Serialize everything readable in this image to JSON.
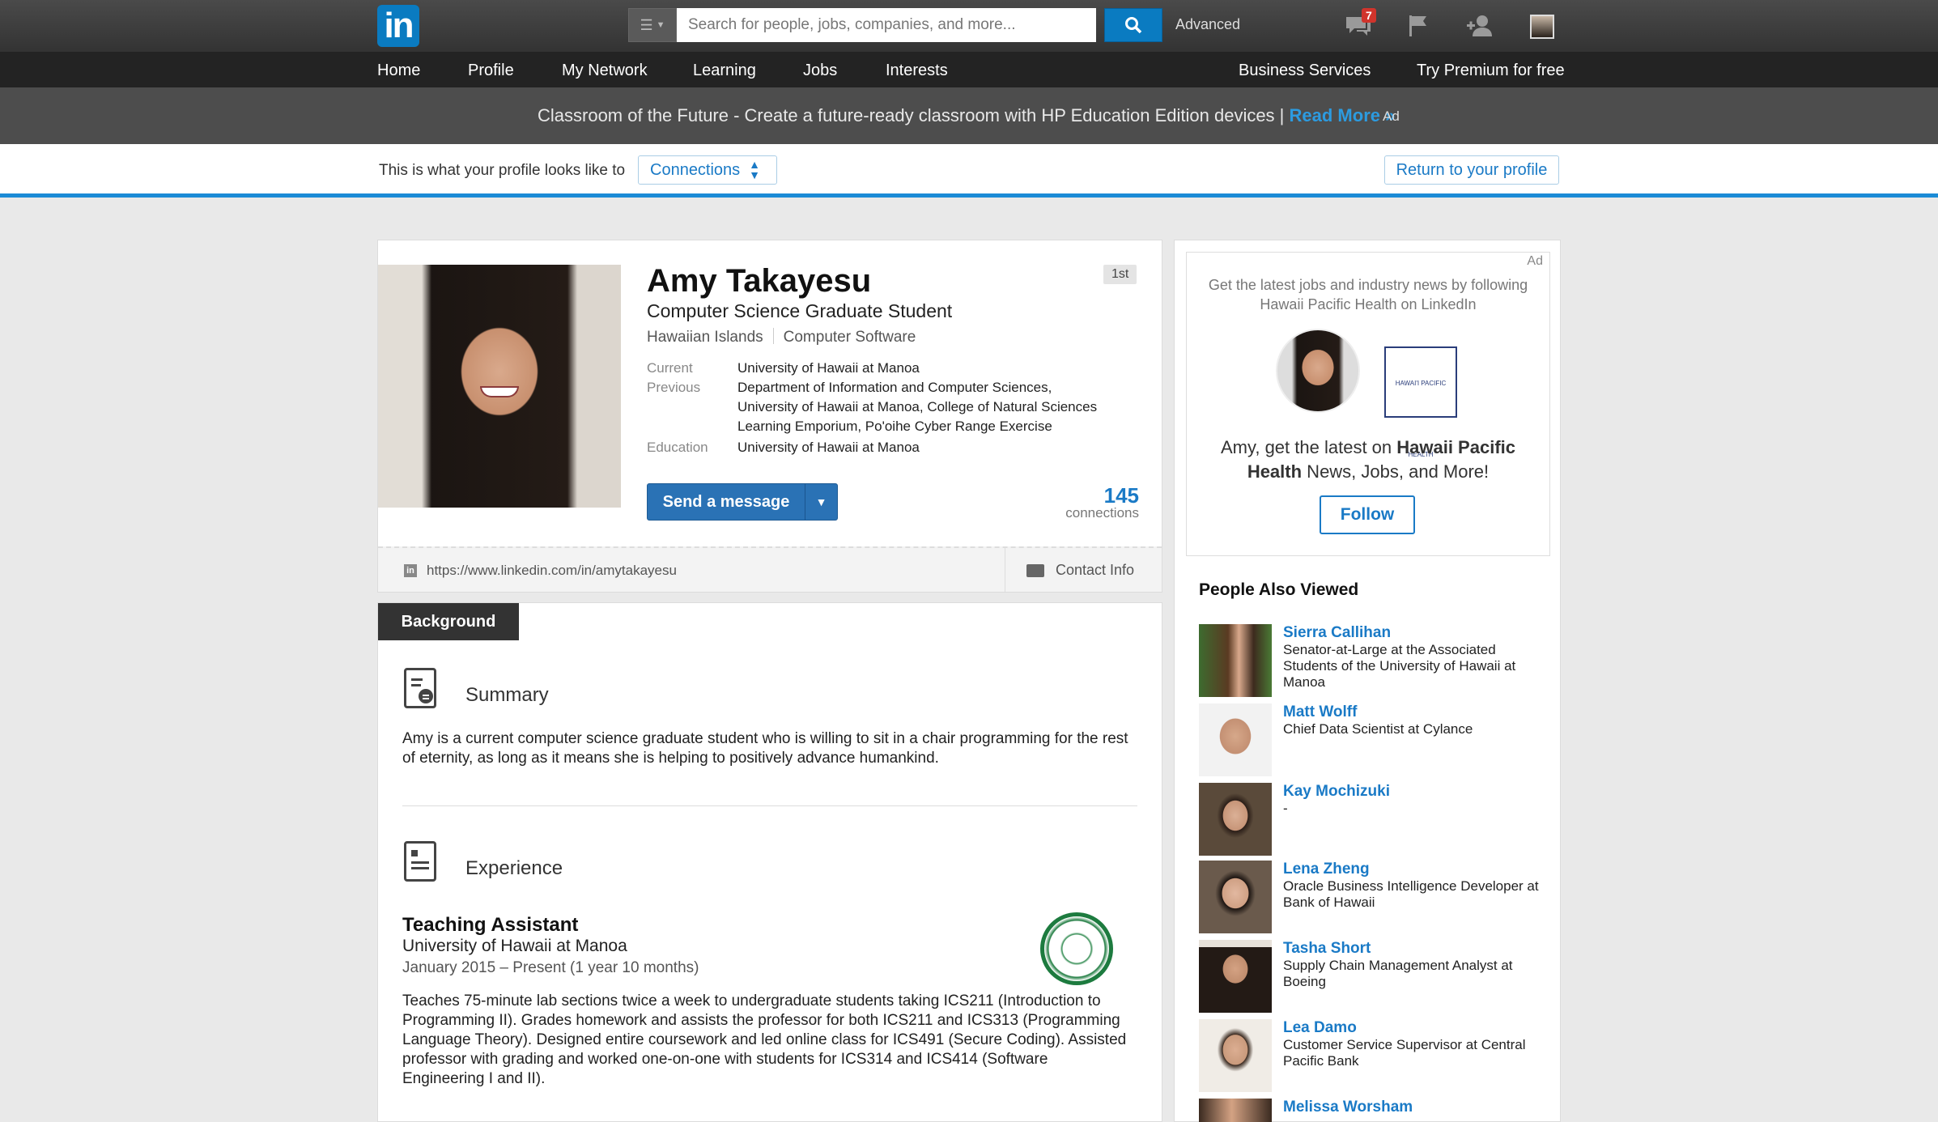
{
  "topbar": {
    "logo_text": "in",
    "search_placeholder": "Search for people, jobs, companies, and more...",
    "advanced_label": "Advanced",
    "messages_badge": "7",
    "brand_color": "#0a7bc1"
  },
  "nav": {
    "items": [
      "Home",
      "Profile",
      "My Network",
      "Learning",
      "Jobs",
      "Interests"
    ],
    "right_items": [
      "Business Services",
      "Try Premium for free"
    ]
  },
  "ad_banner": {
    "text": "Classroom of the Future - Create a future-ready classroom with HP Education Edition devices | ",
    "link": "Read More »",
    "ad_label": "Ad"
  },
  "view_bar": {
    "label": "This is what your profile looks like to",
    "selected_audience": "Connections",
    "return_label": "Return to your profile"
  },
  "profile": {
    "name": "Amy Takayesu",
    "headline": "Computer Science Graduate Student",
    "location": "Hawaiian Islands",
    "industry": "Computer Software",
    "degree": "1st",
    "current_label": "Current",
    "current_value": "University of Hawaii at Manoa",
    "previous_label": "Previous",
    "previous_value_1": "Department of Information and Computer Sciences,",
    "previous_value_2": "University of Hawaii at Manoa, College of Natural Sciences",
    "previous_value_3": "Learning Emporium, Po'oihe Cyber Range Exercise",
    "education_label": "Education",
    "education_value": "University of Hawaii at Manoa",
    "message_button": "Send a message",
    "connections_count": "145",
    "connections_label": "connections",
    "public_url": "https://www.linkedin.com/in/amytakayesu",
    "contact_info_label": "Contact Info"
  },
  "background": {
    "tab_label": "Background",
    "summary_title": "Summary",
    "summary_text": "Amy is a current computer science graduate student who is willing to sit in a chair programming for the rest of eternity, as long as it means she is helping to positively advance humankind.",
    "experience_title": "Experience",
    "job_title": "Teaching Assistant",
    "job_company": "University of Hawaii at Manoa",
    "job_dates": "January 2015 – Present (1 year 10 months)",
    "job_description": "Teaches 75-minute lab sections twice a week to undergraduate students taking ICS211 (Introduction to Programming II). Grades homework and assists the professor for both ICS211 and ICS313 (Programming Language Theory). Designed entire coursework and led online class for ICS491 (Secure Coding). Assisted professor with grading and worked one-on-one with students for ICS314 and ICS414 (Software Engineering I and II)."
  },
  "sidebar_ad": {
    "ad_label": "Ad",
    "top_text": "Get the latest jobs and industry news by following Hawaii Pacific Health on LinkedIn",
    "logo_text": "HAWAI'I PACIFIC HEALTH",
    "message_pre": "Amy, get the latest on ",
    "message_company": "Hawaii Pacific Health",
    "message_post": " News, Jobs, and More!",
    "follow_label": "Follow"
  },
  "people_also_viewed": {
    "title": "People Also Viewed",
    "people": [
      {
        "name": "Sierra Callihan",
        "headline": "Senator-at-Large at the Associated Students of the University of Hawaii at Manoa"
      },
      {
        "name": "Matt Wolff",
        "headline": "Chief Data Scientist at Cylance"
      },
      {
        "name": "Kay Mochizuki",
        "headline": "-"
      },
      {
        "name": "Lena Zheng",
        "headline": "Oracle Business Intelligence Developer at Bank of Hawaii"
      },
      {
        "name": "Tasha Short",
        "headline": "Supply Chain Management Analyst at Boeing"
      },
      {
        "name": "Lea Damo",
        "headline": "Customer Service Supervisor at Central Pacific Bank"
      },
      {
        "name": "Melissa Worsham",
        "headline": ""
      }
    ]
  }
}
